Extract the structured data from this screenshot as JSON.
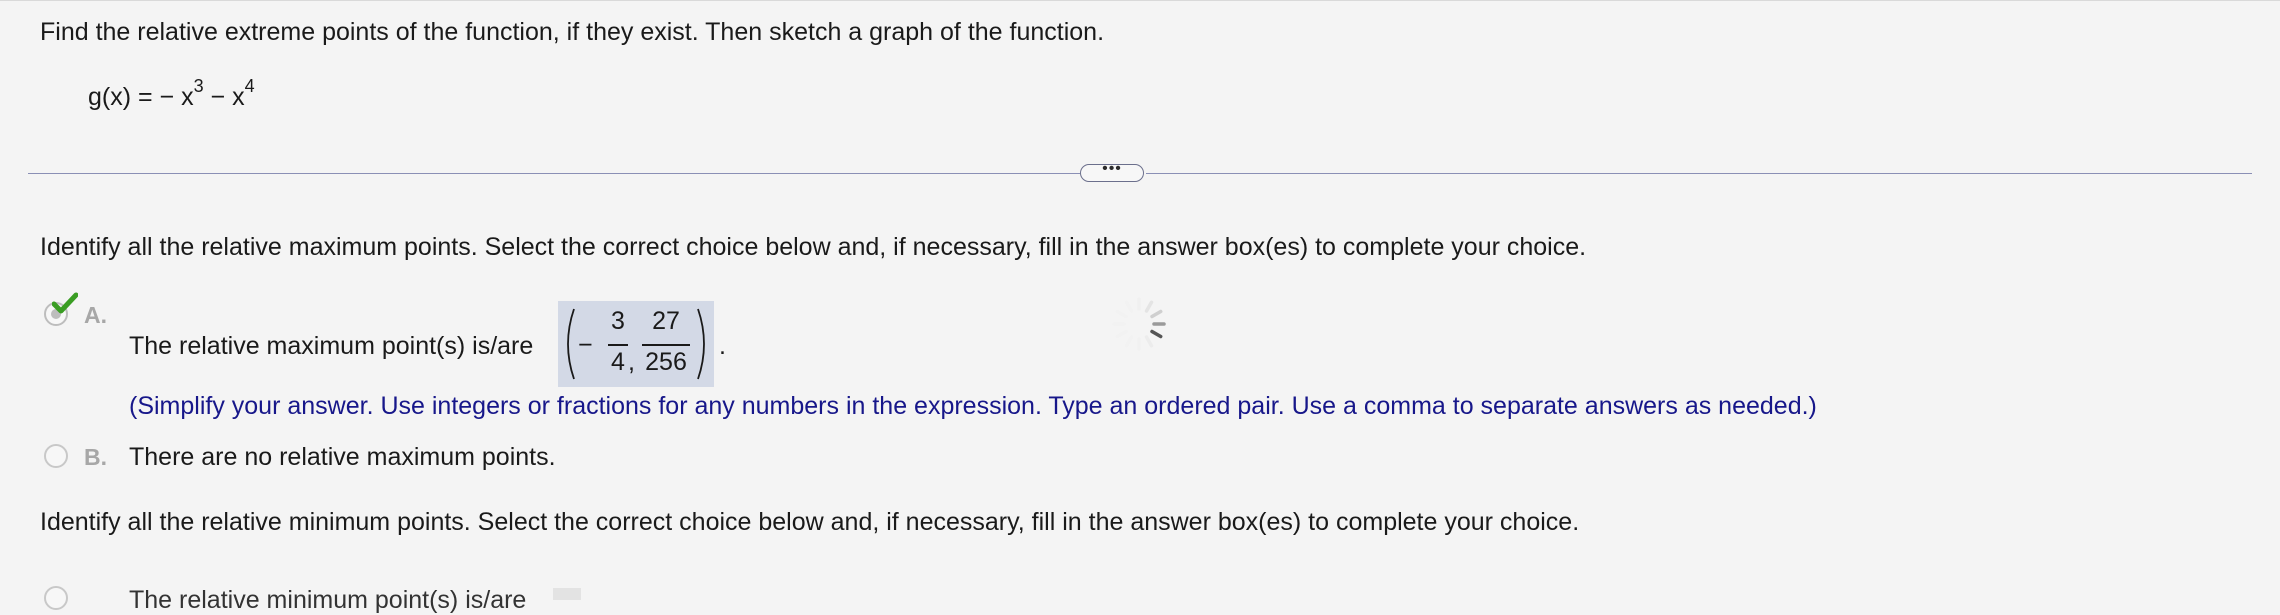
{
  "question": {
    "prompt": "Find the relative extreme points of the function, if they exist. Then sketch a graph of the function.",
    "function_lhs": "g(x) = − x",
    "exp1": "3",
    "function_mid": " − x",
    "exp2": "4"
  },
  "divider": {
    "more_label": "•••"
  },
  "max_section": {
    "instruction": "Identify all the relative maximum points. Select the correct choice below and, if necessary, fill in the answer box(es) to complete your choice.",
    "option_a": {
      "label": "A.",
      "text": "The relative maximum point(s) is/are",
      "selected": true,
      "correct": true,
      "answer": {
        "x_sign": "−",
        "x_num": "3",
        "x_den": "4",
        "y_num": "27",
        "y_den": "256",
        "separator": ","
      },
      "period": ".",
      "hint": "(Simplify your answer. Use integers or fractions for any numbers in the expression. Type an ordered pair. Use a comma to separate answers as needed.)"
    },
    "option_b": {
      "label": "B.",
      "text": "There are no relative maximum points.",
      "selected": false
    }
  },
  "min_section": {
    "instruction": "Identify all the relative minimum points. Select the correct choice below and, if necessary, fill in the answer box(es) to complete your choice.",
    "option_a_partial": "The relative minimum point(s) is/are"
  },
  "colors": {
    "accent_check": "#3a9d23",
    "answer_box": "#d3d9e6",
    "hint_text": "#17178a"
  }
}
